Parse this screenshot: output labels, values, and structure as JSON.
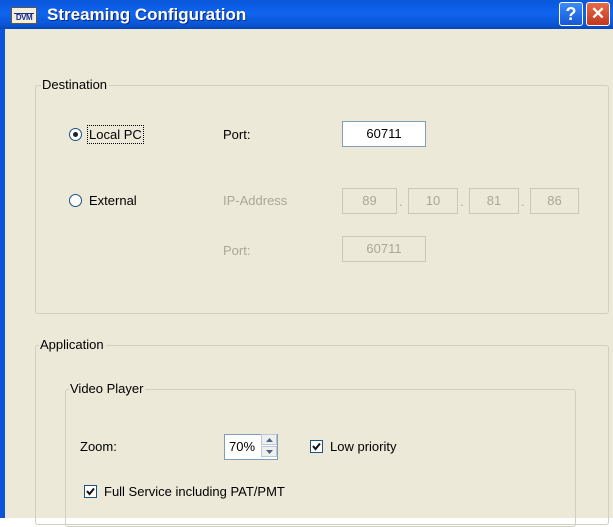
{
  "window": {
    "title": "Streaming Configuration",
    "icon": "DVM",
    "help_label": "?",
    "close_label": "✕"
  },
  "destination": {
    "label": "Destination",
    "local_pc": {
      "label": "Local PC",
      "selected": true,
      "port_label": "Port:",
      "port": "60711"
    },
    "external": {
      "label": "External",
      "selected": false,
      "ip_label": "IP-Address",
      "ip": [
        "89",
        "10",
        "81",
        "86"
      ],
      "ip_separator": ".",
      "port_label": "Port:",
      "port": "60711"
    }
  },
  "application": {
    "label": "Application",
    "video_player": {
      "label": "Video Player",
      "zoom_label": "Zoom:",
      "zoom_value": "70%",
      "low_priority_label": "Low priority",
      "low_priority_checked": true,
      "full_service_label": "Full Service including PAT/PMT",
      "full_service_checked": true
    }
  }
}
